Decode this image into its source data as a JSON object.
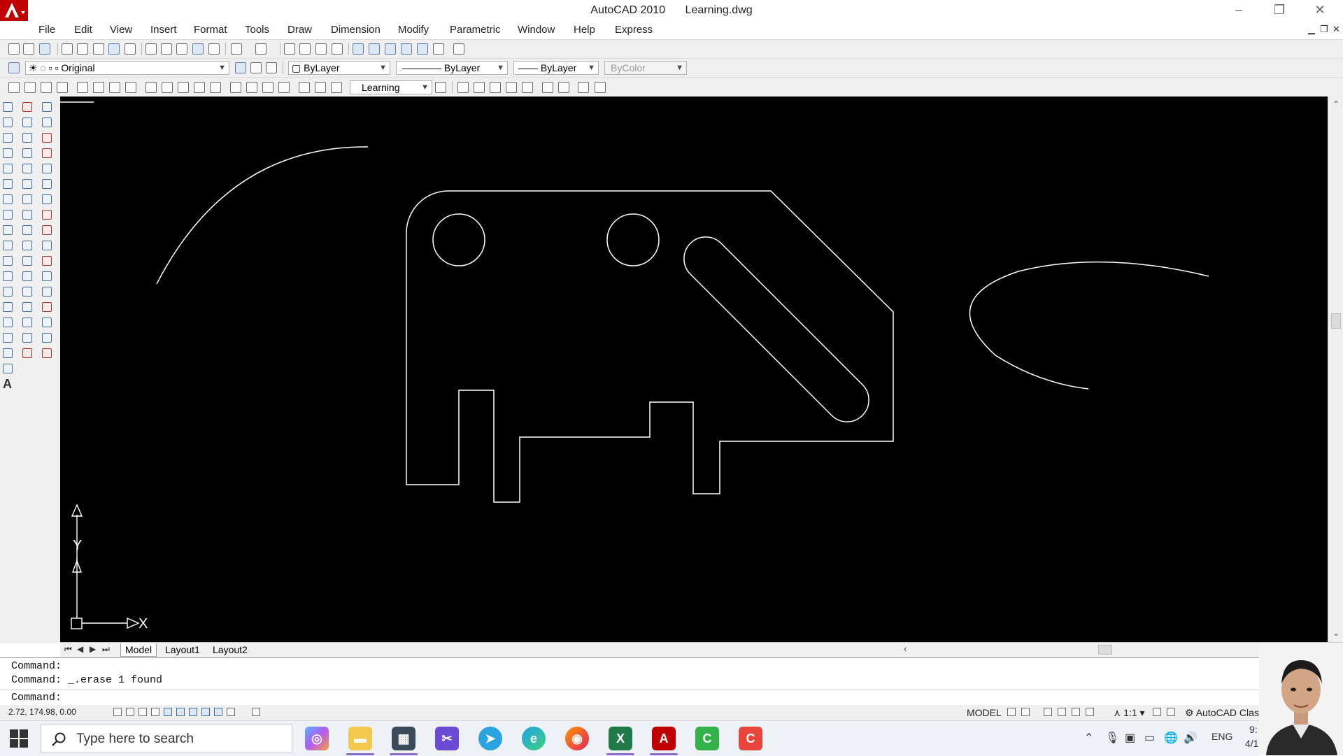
{
  "window": {
    "app_name": "AutoCAD 2010",
    "file_name": "Learning.dwg",
    "minimize_glyph": "–",
    "restore_glyph": "❐",
    "close_glyph": "✕"
  },
  "menu": {
    "items": [
      "File",
      "Edit",
      "View",
      "Insert",
      "Format",
      "Tools",
      "Draw",
      "Dimension",
      "Modify",
      "Parametric",
      "Window",
      "Help",
      "Express"
    ]
  },
  "layers_toolbar": {
    "layer_name": "Original",
    "color": "ByLayer",
    "linetype": "ByLayer",
    "lineweight": "ByLayer",
    "plot_style": "ByColor"
  },
  "styles_toolbar": {
    "workspace": "Learning"
  },
  "canvas": {
    "background": "#000000",
    "ucs_x_label": "X",
    "ucs_y_label": "Y"
  },
  "layout_tabs": [
    "Model",
    "Layout1",
    "Layout2"
  ],
  "command_window": {
    "lines": [
      "Command:",
      "Command:  _.erase 1 found"
    ],
    "prompt": "Command:"
  },
  "statusbar": {
    "coordinates": "2.72, 174.98, 0.00",
    "space": "MODEL",
    "annotation_scale": "1:1",
    "workspace_label": "AutoCAD Clas"
  },
  "taskbar": {
    "search_placeholder": "Type here to search",
    "language": "ENG",
    "time_partial": "9:",
    "date_partial": "4/1"
  },
  "colors": {
    "autocad_red": "#c00000",
    "selection_underline": "#8a6cc8"
  }
}
